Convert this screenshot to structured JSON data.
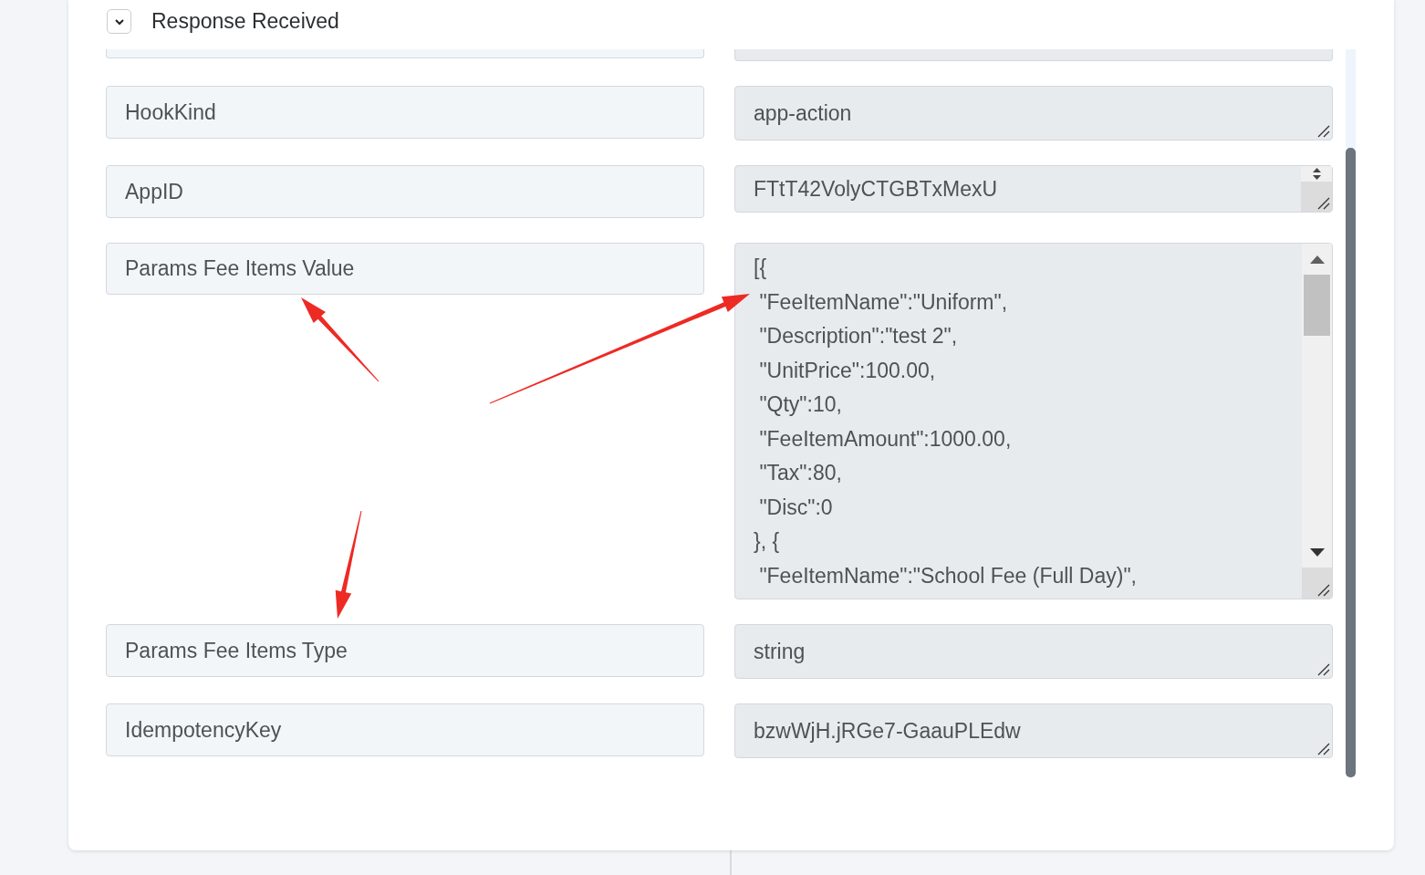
{
  "section": {
    "title": "Response Received",
    "expanded": true
  },
  "rows": [
    {
      "label": "HookKind",
      "kind": "single",
      "value": "app-action"
    },
    {
      "label": "AppID",
      "kind": "spinner",
      "value": "FTtT42VolyCTGBTxMexU"
    },
    {
      "label": "Params Fee Items Value",
      "kind": "multiline",
      "lines": [
        "[{",
        " \"FeeItemName\":\"Uniform\",",
        " \"Description\":\"test 2\",",
        " \"UnitPrice\":100.00,",
        " \"Qty\":10,",
        " \"FeeItemAmount\":1000.00,",
        " \"Tax\":80,",
        " \"Disc\":0",
        "}, {",
        " \"FeeItemName\":\"School Fee (Full Day)\","
      ]
    },
    {
      "label": "Params Fee Items Type",
      "kind": "single",
      "value": "string"
    },
    {
      "label": "IdempotencyKey",
      "kind": "single",
      "value": "bzwWjH.jRGe7-GaauPLEdw"
    }
  ]
}
